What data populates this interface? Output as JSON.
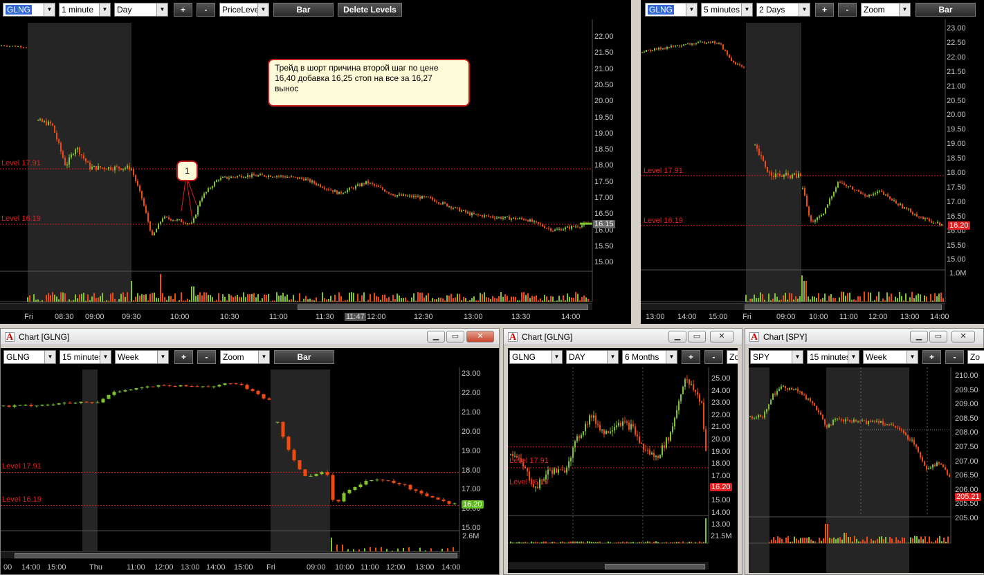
{
  "colors": {
    "bg": "#000000",
    "up": "#7fc52b",
    "down": "#f04a10",
    "level": "#d21e1e",
    "session": "#252525",
    "grid": "#1c1c1c",
    "axis": "#c8c8c8",
    "last_red": "#e02020",
    "last_green": "#5dbb20",
    "last_gray": "#666666"
  },
  "windows": {
    "w1": {
      "toolbar": {
        "symbol": "GLNG",
        "interval": "1 minute",
        "range": "Day",
        "plus": "+",
        "minus": "-",
        "tool": "PriceLeve",
        "chart_type": "Bar",
        "delete": "Delete Levels"
      },
      "yticks": [
        "22.00",
        "21.50",
        "21.00",
        "20.50",
        "20.00",
        "19.50",
        "19.00",
        "18.50",
        "18.00",
        "17.50",
        "17.00",
        "16.50",
        "16.00",
        "15.50",
        "15.00"
      ],
      "xticks": [
        "Fri",
        "08:30",
        "09:00",
        "09:30",
        "10:00",
        "10:30",
        "11:00",
        "11:30",
        "12:00",
        "12:30",
        "13:00",
        "13:30",
        "14:00"
      ],
      "levels": [
        "Level 17.91",
        "Level 16.19"
      ],
      "last": "16.15",
      "time_badge": "11:47",
      "note": [
        "Трейд в шорт причина второй шаг по цене",
        "16,40 добавка 16,25 стоп на все за 16,27",
        "вынос"
      ],
      "callout": "1"
    },
    "w2": {
      "toolbar": {
        "symbol": "GLNG",
        "interval": "5 minutes",
        "range": "2 Days",
        "plus": "+",
        "minus": "-",
        "tool": "Zoom",
        "chart_type": "Bar"
      },
      "yticks": [
        "23.00",
        "22.50",
        "22.00",
        "21.50",
        "21.00",
        "20.50",
        "20.00",
        "19.50",
        "19.00",
        "18.50",
        "18.00",
        "17.50",
        "17.00",
        "16.50",
        "16.00",
        "15.50",
        "15.00"
      ],
      "vol": "1.0M",
      "xticks": [
        "13:00",
        "14:00",
        "15:00",
        "Fri",
        "09:00",
        "10:00",
        "11:00",
        "12:00",
        "13:00",
        "14:00"
      ],
      "levels": [
        "Level 17.91",
        "Level 16.19"
      ],
      "last": "16.20"
    },
    "w3": {
      "title": "Chart [GLNG]",
      "toolbar": {
        "symbol": "GLNG",
        "interval": "15 minutes",
        "range": "Week",
        "plus": "+",
        "minus": "-",
        "tool": "Zoom",
        "chart_type": "Bar"
      },
      "yticks": [
        "23.00",
        "22.00",
        "21.00",
        "20.00",
        "19.00",
        "18.00",
        "17.00",
        "16.00",
        "15.00"
      ],
      "vol": "2.6M",
      "xticks": [
        "00",
        "14:00",
        "15:00",
        "Thu",
        "11:00",
        "12:00",
        "13:00",
        "14:00",
        "15:00",
        "Fri",
        "09:00",
        "10:00",
        "11:00",
        "12:00",
        "13:00",
        "14:00"
      ],
      "levels": [
        "Level 17.91",
        "Level 16.19"
      ],
      "last": "16.20"
    },
    "w4": {
      "title": "Chart [GLNG]",
      "toolbar": {
        "symbol": "GLNG",
        "interval": "DAY",
        "range": "6 Months",
        "plus": "+",
        "minus": "-",
        "tool": "Zo"
      },
      "yticks": [
        "25.00",
        "24.00",
        "23.00",
        "22.00",
        "21.00",
        "20.00",
        "19.00",
        "18.00",
        "17.00",
        "16.00",
        "15.00",
        "14.00",
        "13.00"
      ],
      "vol": "21.5M",
      "levels": [
        "Level 17.91",
        "Level 16.19"
      ],
      "last": "16.20"
    },
    "w5": {
      "title": "Chart [SPY]",
      "toolbar": {
        "symbol": "SPY",
        "interval": "15 minutes",
        "range": "Week",
        "plus": "+",
        "minus": "-",
        "tool": "Zo"
      },
      "yticks": [
        "210.00",
        "209.50",
        "209.00",
        "208.50",
        "208.00",
        "207.50",
        "207.00",
        "206.50",
        "206.00",
        "205.50",
        "205.00"
      ],
      "last": "205.21"
    }
  }
}
